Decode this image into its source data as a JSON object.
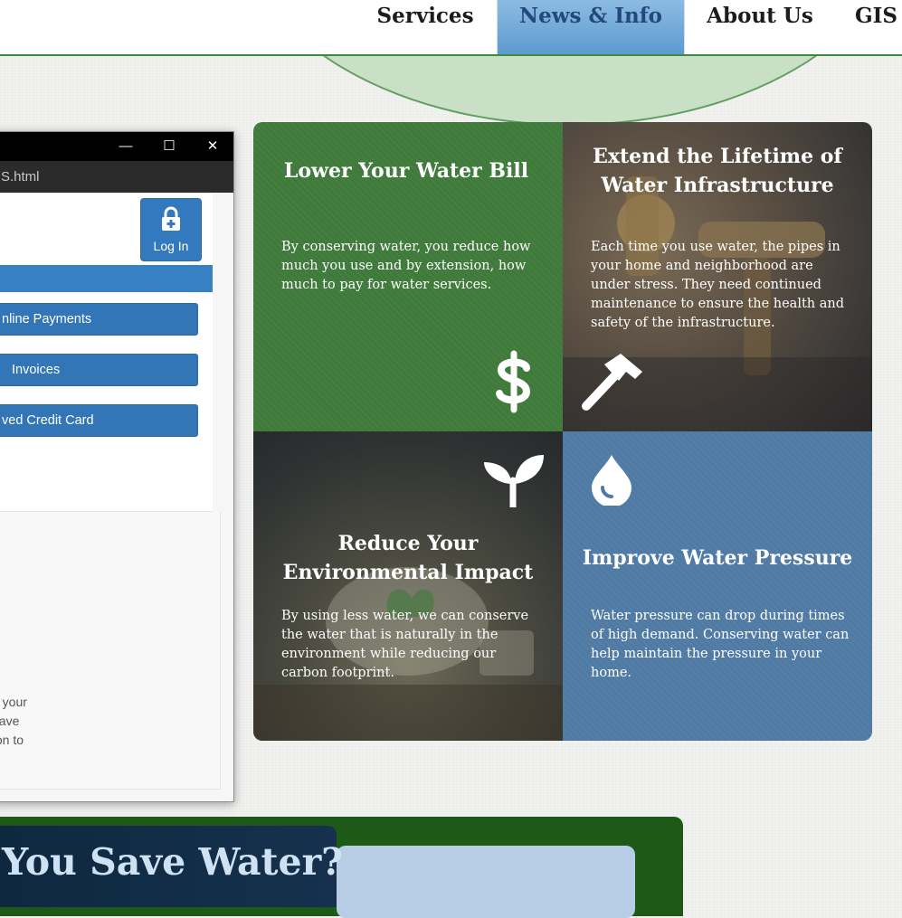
{
  "nav": {
    "items": [
      {
        "label": "Services",
        "active": false
      },
      {
        "label": "News & Info",
        "active": true
      },
      {
        "label": "About Us",
        "active": false
      },
      {
        "label": "GIS",
        "active": false
      }
    ]
  },
  "window": {
    "url_fragment": "S.html",
    "controls": {
      "minimize": "—",
      "maximize": "☐",
      "close": "✕"
    },
    "login_label": "Log In",
    "menu": [
      {
        "label": "nline Payments"
      },
      {
        "label": "Invoices"
      },
      {
        "label": "ved Credit Card"
      }
    ],
    "side_text": [
      "o your",
      " have",
      "ton to"
    ]
  },
  "tiles": [
    {
      "title": "Lower Your Water Bill",
      "text": "By conserving water, you reduce how much you use and by extension, how much to pay for water services.",
      "icon": "dollar-icon"
    },
    {
      "title": "Extend the Lifetime of Water Infrastructure",
      "text": "Each time you use water, the pipes in your home and neighborhood are under stress. They need continued maintenance to ensure the health and safety of the infrastructure.",
      "icon": "hammer-icon"
    },
    {
      "title": "Reduce Your Environmental Impact",
      "text": "By using less water, we can conserve the water that is naturally in the environment while reducing our carbon footprint.",
      "icon": "sprout-icon"
    },
    {
      "title": "Improve Water Pressure",
      "text": "Water pressure can drop during times of high demand. Conserving water can help maintain the pressure in your home.",
      "icon": "water-drop-icon"
    }
  ],
  "banner": {
    "text": "You Save Water?"
  },
  "colors": {
    "green": "#3f7a3b",
    "blue": "#4f7aa3",
    "nav_active": "#6ea7d8",
    "banner": "#15314d"
  }
}
